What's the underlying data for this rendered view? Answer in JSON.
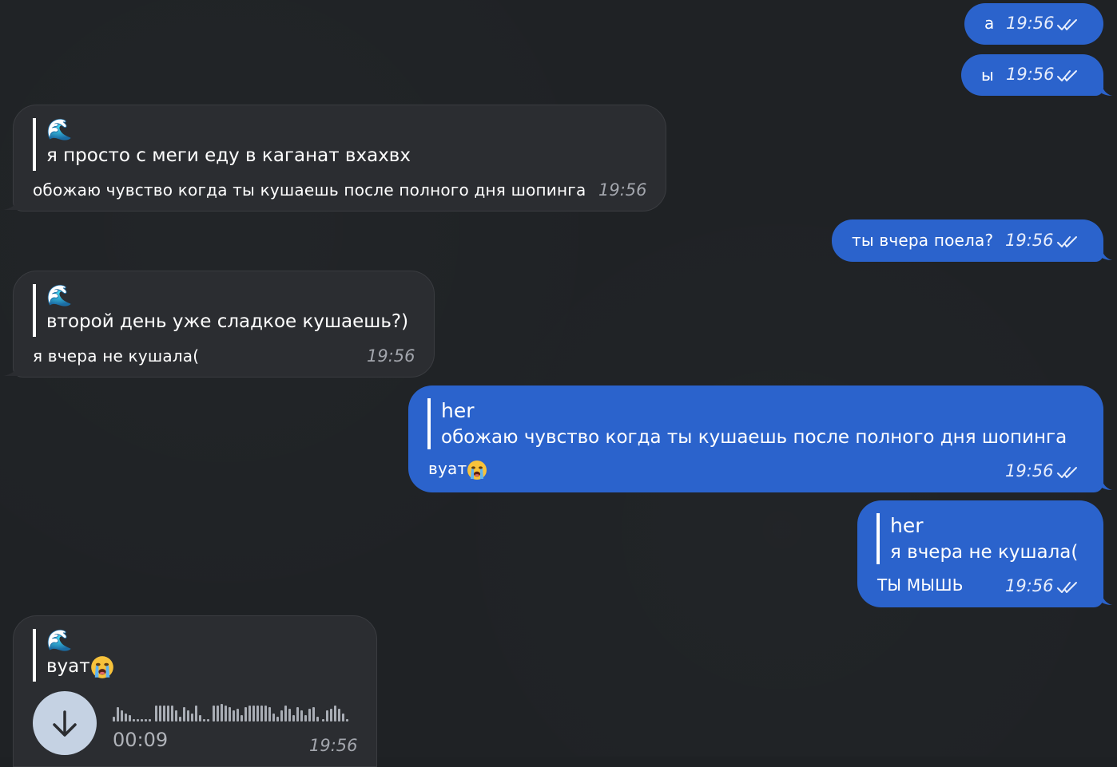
{
  "messages": [
    {
      "id": "m1",
      "dir": "out",
      "text": "а",
      "time": "19:56"
    },
    {
      "id": "m2",
      "dir": "out",
      "text": "ы",
      "time": "19:56"
    },
    {
      "id": "m3",
      "dir": "in",
      "reply_author": "🌊",
      "reply_text": "я просто с меги еду в каганат вхахвх",
      "text": "обожаю чувство когда ты кушаешь после полного дня шопинга",
      "time": "19:56"
    },
    {
      "id": "m4",
      "dir": "out",
      "text": "ты вчера поела?",
      "time": "19:56"
    },
    {
      "id": "m5",
      "dir": "in",
      "reply_author": "🌊",
      "reply_text": "второй день уже сладкое кушаешь?)",
      "text": "я вчера не кушала(",
      "time": "19:56"
    },
    {
      "id": "m6",
      "dir": "out",
      "reply_author": "her",
      "reply_text": "обожаю чувство когда ты кушаешь после полного дня шопинга",
      "text": "вуат",
      "time": "19:56"
    },
    {
      "id": "m7",
      "dir": "out",
      "reply_author": "her",
      "reply_text": "я вчера не кушала(",
      "text": "ТЫ МЫШЬ",
      "time": "19:56"
    },
    {
      "id": "m8",
      "dir": "in",
      "reply_author": "🌊",
      "reply_text": "вуат",
      "voice_duration": "00:09",
      "time": "19:56"
    }
  ],
  "icons": {
    "read_receipt": "double-check-icon",
    "download": "arrow-down-icon",
    "crying_emoji": "loudly-crying-face-emoji"
  },
  "colors": {
    "background": "#1f2225",
    "incoming_bubble": "#2b2d31",
    "outgoing_bubble": "#2b63cc",
    "voice_button": "#c5d2e3"
  }
}
